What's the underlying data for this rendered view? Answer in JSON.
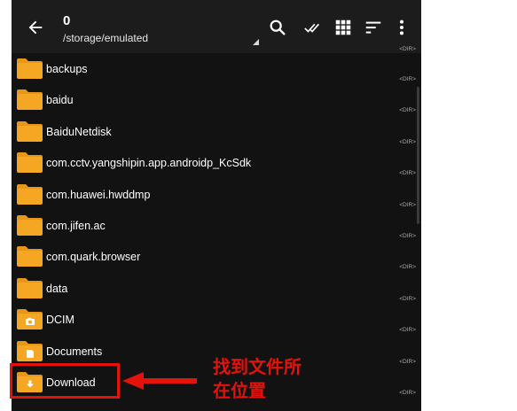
{
  "toolbar": {
    "title": "0",
    "path": "/storage/emulated",
    "icons": [
      "back-arrow-icon",
      "search-icon",
      "double-check-icon",
      "grid-view-icon",
      "sort-icon",
      "more-vertical-icon"
    ]
  },
  "dir_label": "<DIR>",
  "files": [
    {
      "name": "backups",
      "folder_badge": ""
    },
    {
      "name": "baidu",
      "folder_badge": ""
    },
    {
      "name": "BaiduNetdisk",
      "folder_badge": ""
    },
    {
      "name": "com.cctv.yangshipin.app.androidp_KcSdk",
      "folder_badge": ""
    },
    {
      "name": "com.huawei.hwddmp",
      "folder_badge": ""
    },
    {
      "name": "com.jifen.ac",
      "folder_badge": ""
    },
    {
      "name": "com.quark.browser",
      "folder_badge": ""
    },
    {
      "name": "data",
      "folder_badge": ""
    },
    {
      "name": "DCIM",
      "folder_badge": "camera"
    },
    {
      "name": "Documents",
      "folder_badge": "document"
    },
    {
      "name": "Download",
      "folder_badge": "download"
    }
  ],
  "annotation": {
    "line1": "找到文件所",
    "line2": "在位置",
    "color": "#e3120b"
  },
  "colors": {
    "folder": "#f5a623",
    "folder_tab": "#e8961a",
    "background": "#121212",
    "toolbar": "#1c1c1c"
  }
}
